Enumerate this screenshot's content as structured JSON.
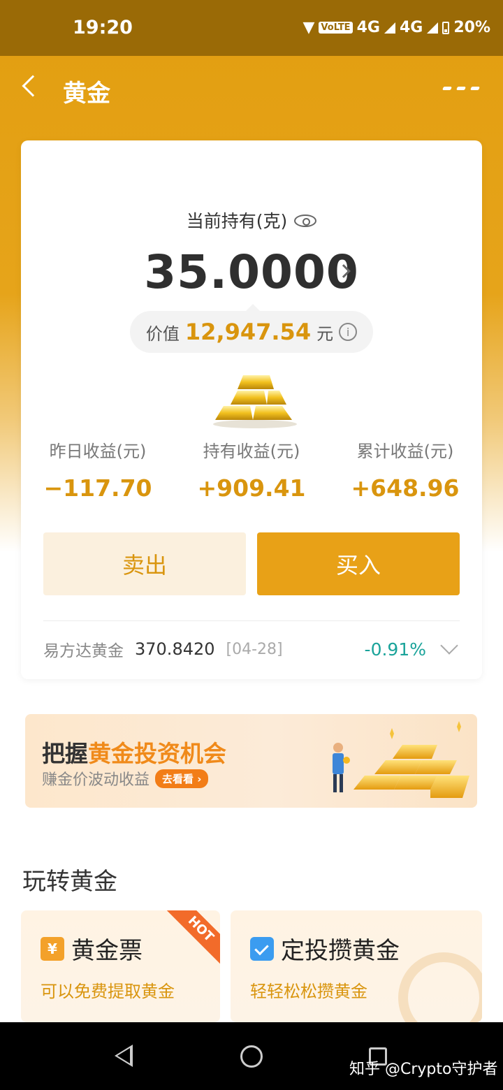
{
  "status_bar": {
    "time": "19:20",
    "volte": "VoLTE",
    "net1": "4G",
    "net2": "4G",
    "battery": "20%"
  },
  "header": {
    "title": "黄金"
  },
  "holding": {
    "label": "当前持有(克)",
    "grams": "35.0000",
    "value_label": "价值",
    "value_amount": "12,947.54",
    "value_unit": "元"
  },
  "stats": [
    {
      "label": "昨日收益(元)",
      "value": "−117.70"
    },
    {
      "label": "持有收益(元)",
      "value": "+909.41"
    },
    {
      "label": "累计收益(元)",
      "value": "+648.96"
    }
  ],
  "actions": {
    "sell_label": "卖出",
    "buy_label": "买入"
  },
  "fund": {
    "name": "易方达黄金",
    "nav": "370.8420",
    "date": "[04-28]",
    "change": "-0.91%"
  },
  "banner": {
    "title_prefix": "把握",
    "title_highlight": "黄金投资机会",
    "subtitle": "赚金价波动收益",
    "cta": "去看看 ›"
  },
  "section": {
    "title": "玩转黄金"
  },
  "tiles": [
    {
      "title": "黄金票",
      "subtitle": "可以免费提取黄金",
      "badge": "HOT",
      "icon_glyph": "¥"
    },
    {
      "title": "定投攒黄金",
      "subtitle": "轻轻松松攒黄金"
    }
  ],
  "watermark": "知乎 @Crypto守护者",
  "colors": {
    "gold": "#e8a117",
    "gold_text": "#d9950e",
    "status_bg": "#9a6a06",
    "teal": "#1aa39a",
    "hot": "#f26b2a"
  }
}
